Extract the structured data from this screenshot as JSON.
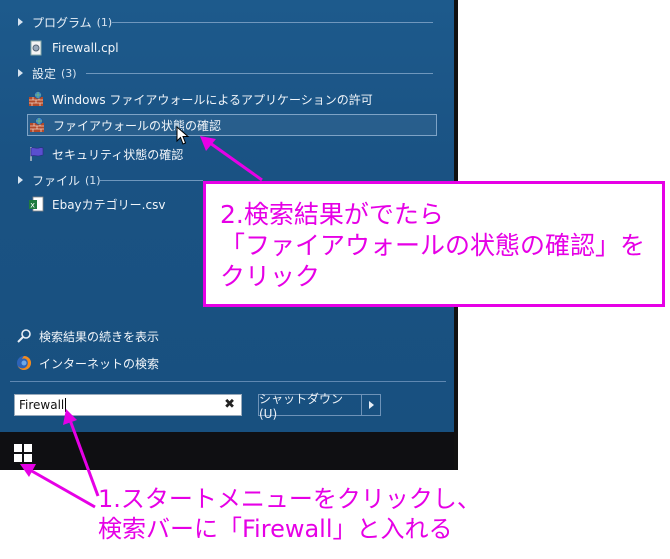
{
  "start_menu": {
    "groups": [
      {
        "label": "プログラム",
        "count": "(1)"
      },
      {
        "label": "設定",
        "count": "(3)"
      },
      {
        "label": "ファイル",
        "count": "(1)"
      }
    ],
    "items": [
      {
        "label": "Firewall.cpl",
        "icon": "control-panel-icon"
      },
      {
        "label": "Windows ファイアウォールによるアプリケーションの許可",
        "icon": "firewall-icon"
      },
      {
        "label": "ファイアウォールの状態の確認",
        "icon": "firewall-icon",
        "selected": true
      },
      {
        "label": "セキュリティ状態の確認",
        "icon": "flag-icon"
      },
      {
        "label": "Ebayカテゴリー.csv",
        "icon": "excel-file-icon"
      }
    ],
    "bottom_links": [
      {
        "label": "検索結果の続きを表示",
        "icon": "search-icon"
      },
      {
        "label": "インターネットの検索",
        "icon": "firefox-icon"
      }
    ],
    "search": {
      "value": "Firewall",
      "clear_glyph": "✖"
    },
    "shutdown_label": "シャットダウン(U)"
  },
  "annotations": {
    "step2": [
      "2.検索結果がでたら",
      "「ファイアウォールの状態の確認」を",
      "クリック"
    ],
    "step1": [
      "1.スタートメニューをクリックし、",
      "検索バーに「Firewall」と入れる"
    ],
    "color": "#e600e6"
  }
}
